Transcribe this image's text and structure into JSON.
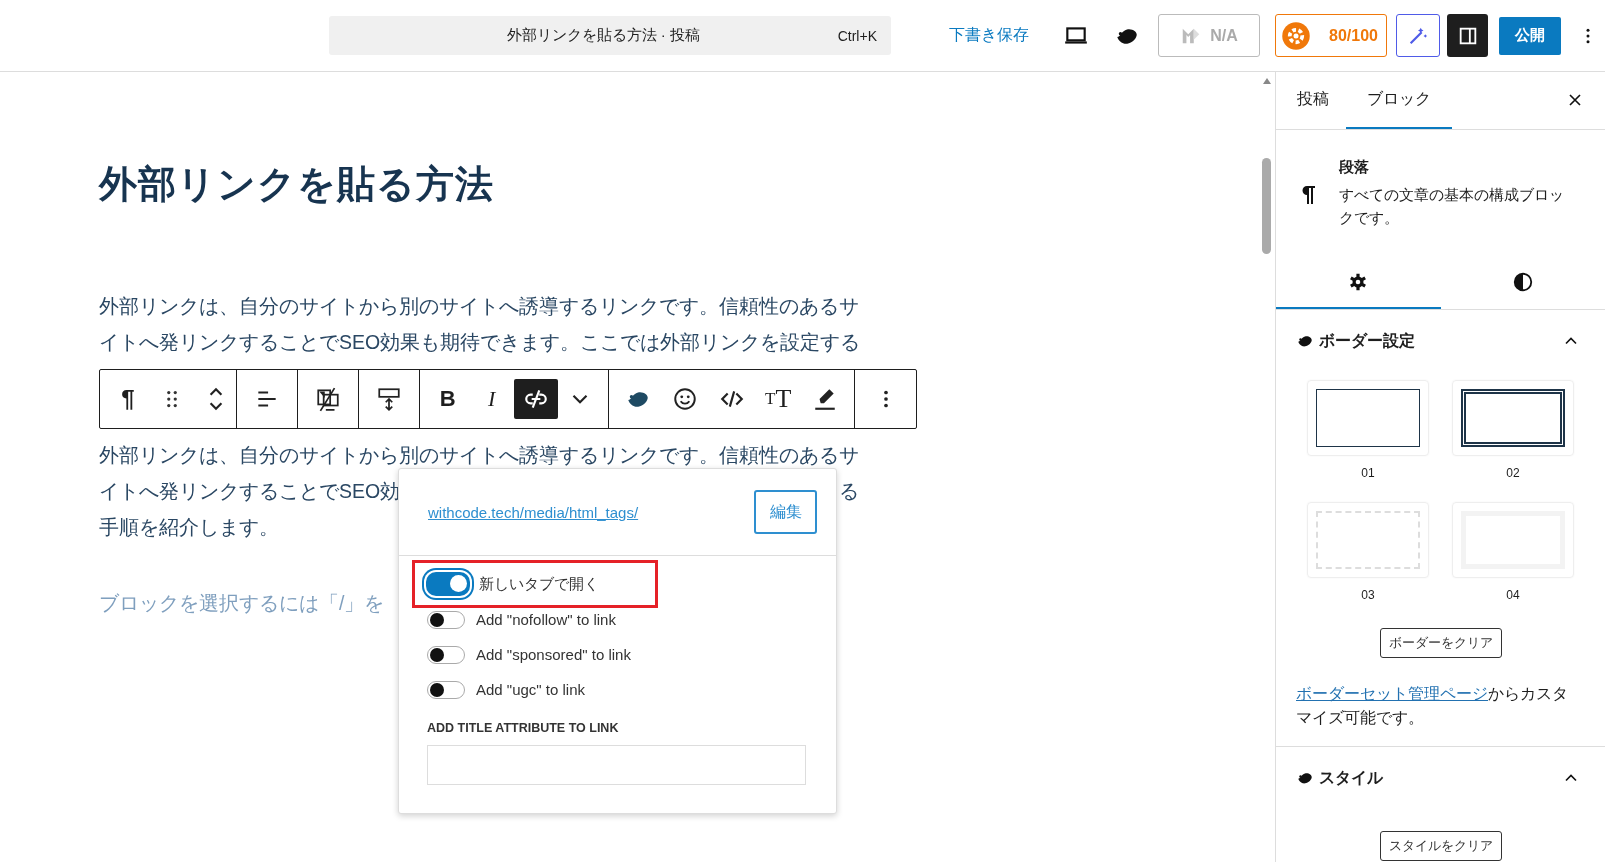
{
  "top_bar": {
    "command": {
      "title": "外部リンクを貼る方法 · 投稿",
      "shortcut": "Ctrl+K"
    },
    "save_draft": "下書き保存",
    "seo_status": "N/A",
    "score": "80/100",
    "sidebar_open": true,
    "publish": "公開"
  },
  "editor": {
    "title": "外部リンクを貼る方法",
    "paragraphs": [
      {
        "lines": [
          [
            "外部リンクは、自分のサイトから別のサイトへ誘導するリンクです。信頼性のあるサ"
          ],
          [
            "イトへ発リンクすることでSEO効果も期待できます。ここでは外部リンクを設定する"
          ]
        ]
      },
      {
        "lines": [
          [
            "外部リンクは、自分のサイトから別のサイトへ誘導するリンクです。信頼性のあるサ"
          ],
          [
            "イトへ発リンクすることでSEO効",
            "る"
          ],
          [
            "手順を紹介します。"
          ]
        ]
      }
    ],
    "placeholder": "ブロックを選択するには「/」を",
    "toolbar": {
      "groups": [
        [
          {
            "kind": "glyph",
            "label": "¶",
            "active": false
          },
          {
            "kind": "drag",
            "active": false
          },
          {
            "kind": "mover",
            "active": false
          }
        ],
        [
          {
            "kind": "align",
            "active": false
          }
        ],
        [
          {
            "kind": "device",
            "active": false
          }
        ],
        [
          {
            "kind": "spacing",
            "active": false
          }
        ],
        [
          {
            "kind": "bold",
            "label": "B",
            "active": false
          },
          {
            "kind": "italic",
            "label": "I",
            "active": false
          },
          {
            "kind": "link",
            "active": true
          },
          {
            "kind": "dropdown",
            "active": false
          }
        ],
        [
          {
            "kind": "bird",
            "active": false
          },
          {
            "kind": "emoji",
            "active": false
          },
          {
            "kind": "code",
            "active": false
          },
          {
            "kind": "typography",
            "label": "TT",
            "active": false
          },
          {
            "kind": "highlight",
            "active": false
          }
        ],
        [
          {
            "kind": "more",
            "active": false
          }
        ]
      ]
    },
    "link_popover": {
      "url": "withcode.tech/media/html_tags/",
      "edit": "編集",
      "options": [
        {
          "label": "新しいタブで開く",
          "on": true,
          "highlighted": true
        },
        {
          "label": "Add \"nofollow\" to link",
          "on": false,
          "highlighted": false
        },
        {
          "label": "Add \"sponsored\" to link",
          "on": false,
          "highlighted": false
        },
        {
          "label": "Add \"ugc\" to link",
          "on": false,
          "highlighted": false
        }
      ],
      "title_label": "ADD TITLE ATTRIBUTE TO LINK"
    }
  },
  "sidebar": {
    "tabs": [
      {
        "label": "投稿",
        "selected": false
      },
      {
        "label": "ブロック",
        "selected": true
      }
    ],
    "block": {
      "name": "段落",
      "description": "すべての文章の基本の構成ブロックです。"
    },
    "inspector_tabs": [
      {
        "kind": "settings",
        "selected": true
      },
      {
        "kind": "styles",
        "selected": false
      }
    ],
    "panels": [
      {
        "title": "ボーダー設定",
        "expanded": true,
        "presets": [
          {
            "kind": "solid",
            "label": "01"
          },
          {
            "kind": "double",
            "label": "02"
          },
          {
            "kind": "dashed",
            "label": "03"
          },
          {
            "kind": "thick",
            "label": "04"
          }
        ],
        "clear_button": "ボーダーをクリア",
        "note": {
          "link": "ボーダーセット管理ページ",
          "text": "からカスタマイズ可能です。"
        }
      },
      {
        "title": "スタイル",
        "expanded": true,
        "clear_button": "スタイルをクリア"
      }
    ]
  }
}
